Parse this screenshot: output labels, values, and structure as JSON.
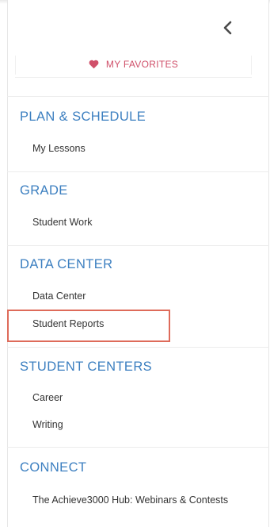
{
  "header": {
    "back_icon": "chevron-left-icon"
  },
  "favorites": {
    "label": "MY FAVORITES",
    "icon": "heart-icon",
    "color": "#d0506a"
  },
  "sections": [
    {
      "title": "PLAN & SCHEDULE",
      "items": [
        "My Lessons"
      ]
    },
    {
      "title": "GRADE",
      "items": [
        "Student Work"
      ]
    },
    {
      "title": "DATA CENTER",
      "items": [
        "Data Center",
        "Student Reports"
      ]
    },
    {
      "title": "STUDENT CENTERS",
      "items": [
        "Career",
        "Writing"
      ]
    },
    {
      "title": "CONNECT",
      "items": [
        "The Achieve3000 Hub: Webinars & Contests"
      ]
    }
  ],
  "highlighted_item": "Student Reports",
  "colors": {
    "section_title": "#3c7fc0",
    "highlight_border": "#de6b5a",
    "item_text": "#333333"
  }
}
